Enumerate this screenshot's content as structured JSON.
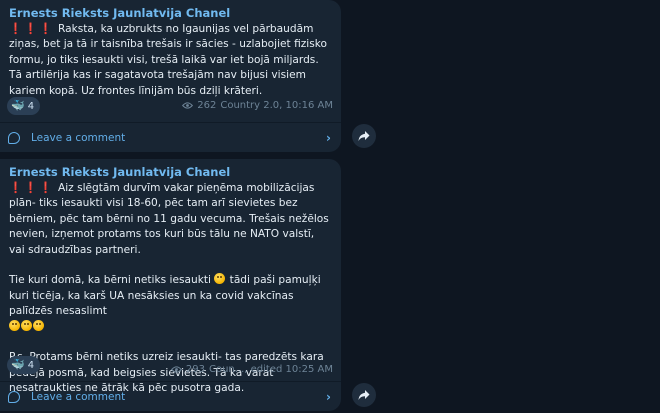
{
  "posts": [
    {
      "author": "Ernests Rieksts Jaunlatvija Chanel",
      "lead_marks": "❗❗❗",
      "text": " Raksta, ka uzbrukts no Igaunijas vel pārbaudām ziņas, bet ja tā ir taisnība trešais ir sācies - uzlabojiet fizisko formu, jo tiks iesaukti visi, trešā laikā var iet bojā miljards. Tā artilērija kas ir sagatavota trešajām nav bijusi visiem kariem kopā. Uz frontes līnijām būs dziļi krāteri.",
      "reaction_emoji": "🐳",
      "reaction_count": "4",
      "views": "262",
      "meta": "Country 2.0, 10:16 AM",
      "comment_label": "Leave a comment"
    },
    {
      "author": "Ernests Rieksts Jaunlatvija Chanel",
      "lead_marks": "❗❗❗",
      "text_p1": " Aiz slēgtām durvīm vakar pieņēma mobilizācijas plān- tiks iesaukti visi 18-60, pēc tam arī sievietes bez bērniem, pēc tam bērni no 11 gadu vecuma. Trešais nežēlos nevien, izņemot protams tos kuri būs tālu ne NATO valstī, vai sdraudzības partneri.",
      "text_p2a": "Tie kuri domā, ka bērni netiks iesaukti ",
      "text_p2b": " tādi paši pamuļķi kuri ticēja, ka karš UA nesāksies un ka covid vakcīnas palīdzēs nesaslimt",
      "text_p3": "P.s. Protams bērni netiks uzreiz iesaukti- tas paredzēts kara pēdējā posmā, kad beigsies sievietes. Tā ka varat nesatraukties ne ātrāk kā pēc pusotra gada.",
      "reaction_emoji": "🐳",
      "reaction_count": "4",
      "views": "293",
      "meta": "Coun..., edited 10:25 AM",
      "comment_label": "Leave a comment"
    }
  ],
  "icons": {
    "eye": "eye-icon",
    "comment": "comment-icon",
    "chevron": "chevron-right-icon",
    "share": "share-arrow-icon"
  },
  "colors": {
    "background": "#0e1621",
    "bubble": "#182533",
    "accent": "#62aee8",
    "author": "#71baf0",
    "meta": "#6d8396"
  }
}
